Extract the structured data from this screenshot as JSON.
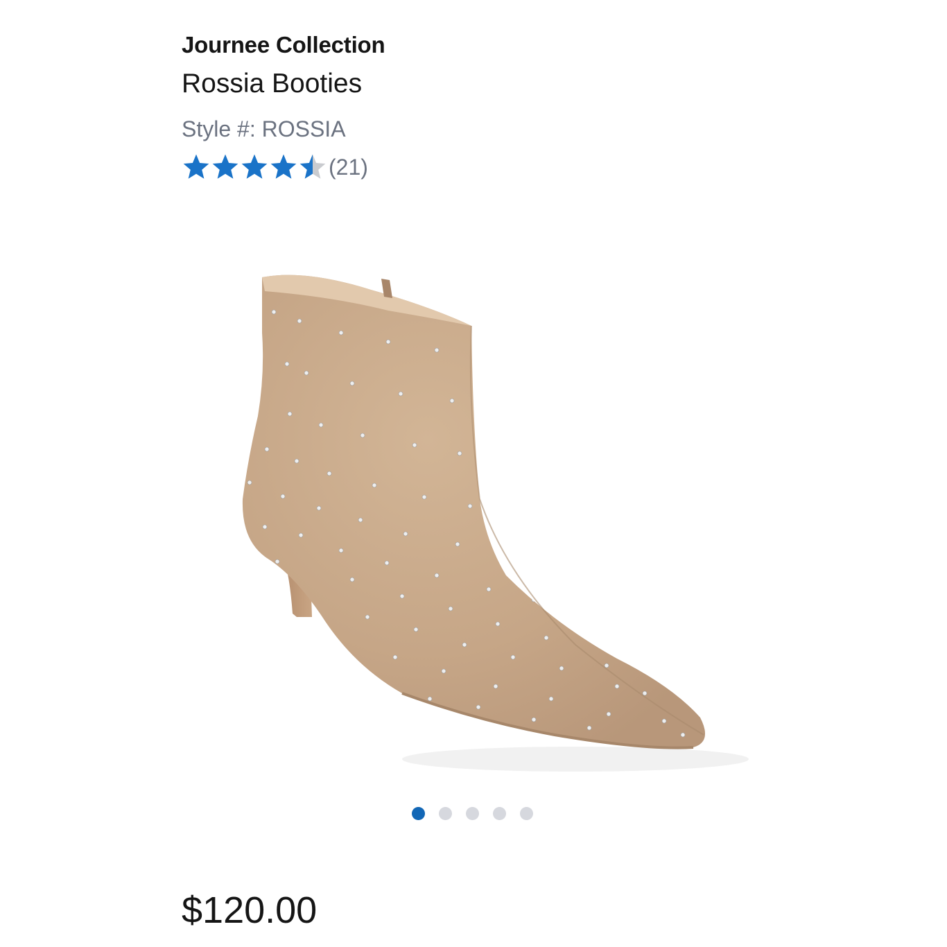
{
  "product": {
    "brand": "Journee Collection",
    "name": "Rossia Booties",
    "style_text": "Style #: ROSSIA",
    "rating": {
      "value": 4.5,
      "max": 5,
      "review_count_text": "(21)",
      "star_color": "#1a73c8",
      "empty_star_color": "#c9cbcf"
    },
    "image": {
      "description_icon": "ankle-bootie-icon",
      "color": "#c8a98a"
    },
    "price": "$120.00"
  },
  "carousel": {
    "total_slides": 5,
    "active_index": 0,
    "active_color": "#1267b6",
    "inactive_color": "#d6d8de"
  }
}
